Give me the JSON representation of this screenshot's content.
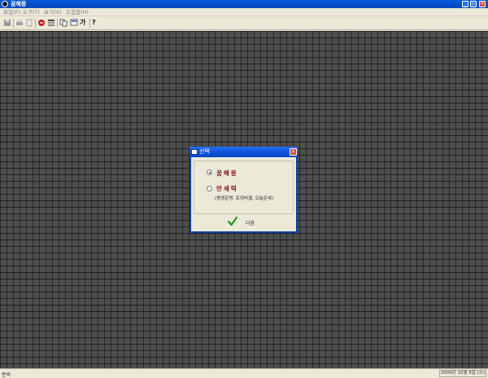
{
  "window": {
    "title": "꿈해몽"
  },
  "menu": {
    "items": [
      {
        "label": "파일(F)"
      },
      {
        "label": "도구(T)"
      },
      {
        "label": "보기(V)"
      },
      {
        "label": "도움말(H)"
      }
    ]
  },
  "toolbar": {
    "buttons": [
      {
        "icon": "save-icon"
      },
      {
        "icon": "print-icon"
      },
      {
        "icon": "preview-icon"
      },
      {
        "icon": "stop-icon"
      },
      {
        "icon": "list-icon"
      },
      {
        "icon": "copy-icon"
      },
      {
        "icon": "screen-icon"
      },
      {
        "icon": "font-icon",
        "label": "가"
      },
      {
        "icon": "help-icon",
        "label": "?"
      }
    ]
  },
  "dialog": {
    "title": "선택",
    "options": [
      {
        "label": "꿈해몽",
        "selected": true
      },
      {
        "label": "만세력",
        "selected": false,
        "description": "(평생운명, 토정비결, 오늘운세)"
      }
    ],
    "next_label": "다음"
  },
  "status": {
    "left": "준비",
    "date": "2009년 10월 6일 (火)"
  },
  "colors": {
    "titlebar": "#0a52da",
    "close": "#d6462c",
    "option_text": "#7a1010",
    "brick": "#4d4d4d"
  }
}
